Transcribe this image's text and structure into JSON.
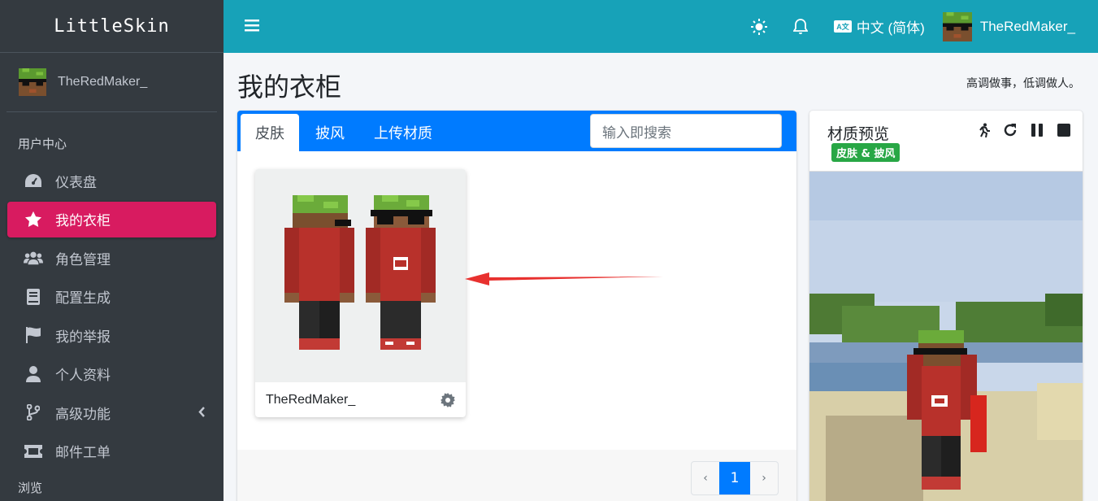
{
  "brand": "LittleSkin",
  "user": {
    "name": "TheRedMaker_"
  },
  "sidebar": {
    "section_title": "用户中心",
    "items": [
      {
        "label": "仪表盘",
        "icon": "dashboard-icon"
      },
      {
        "label": "我的衣柜",
        "icon": "star-icon",
        "active": true
      },
      {
        "label": "角色管理",
        "icon": "users-icon"
      },
      {
        "label": "配置生成",
        "icon": "book-icon"
      },
      {
        "label": "我的举报",
        "icon": "flag-icon"
      },
      {
        "label": "个人资料",
        "icon": "user-icon"
      },
      {
        "label": "高级功能",
        "icon": "branch-icon"
      },
      {
        "label": "邮件工单",
        "icon": "ticket-icon"
      }
    ],
    "section_title_2": "浏览"
  },
  "topbar": {
    "language": "中文 (简体)",
    "username": "TheRedMaker_"
  },
  "page": {
    "title": "我的衣柜",
    "motto": "高调做事，低调做人。"
  },
  "closet": {
    "tabs": [
      "皮肤",
      "披风",
      "上传材质"
    ],
    "active_tab": "皮肤",
    "search_placeholder": "输入即搜索",
    "items": [
      {
        "name": "TheRedMaker_"
      }
    ],
    "pagination": {
      "prev": "‹",
      "current": "1",
      "next": "›"
    }
  },
  "preview": {
    "title": "材质预览",
    "badge": "皮肤 & 披风"
  },
  "colors": {
    "sidebar_bg": "#343a40",
    "topbar_bg": "#17a2b8",
    "active_nav": "#d81b60",
    "tab_header": "#007bff",
    "badge_green": "#28a745"
  }
}
